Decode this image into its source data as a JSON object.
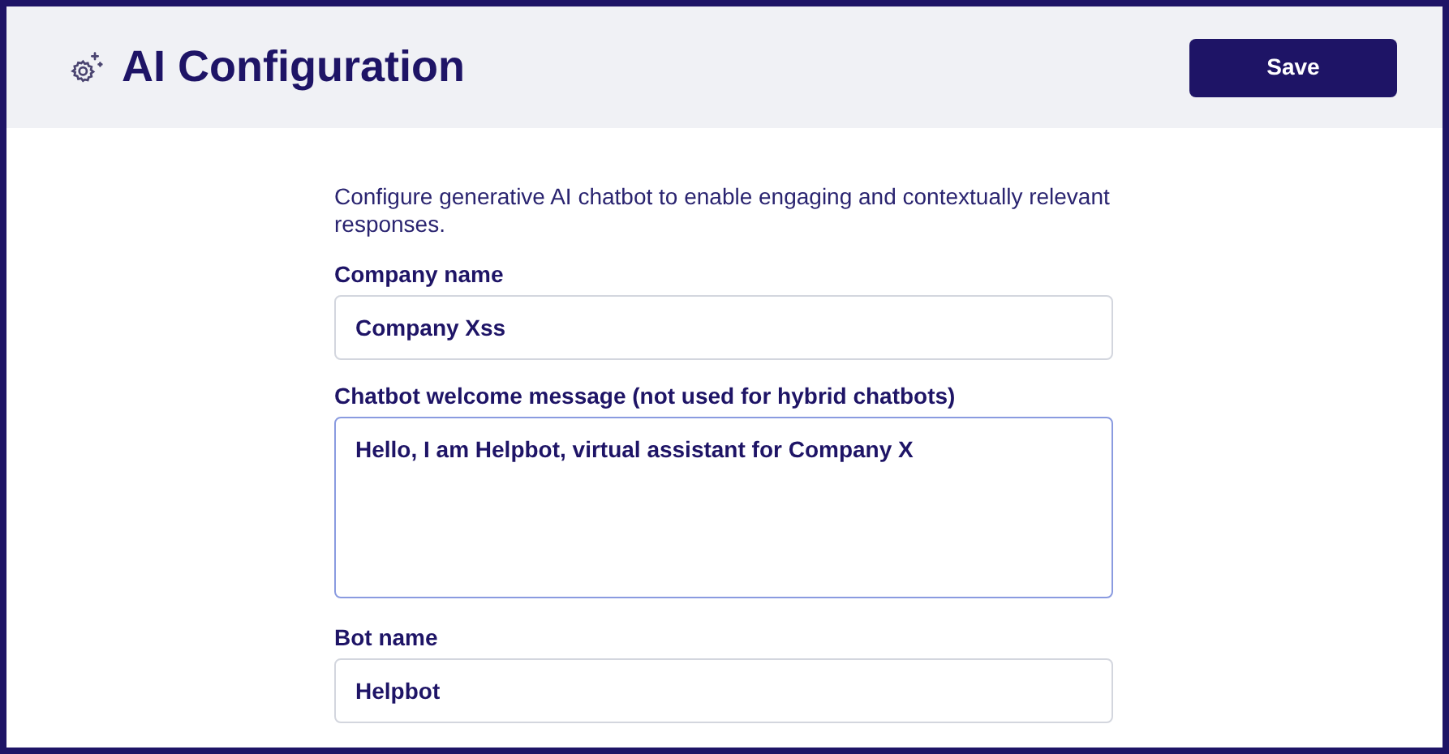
{
  "header": {
    "title": "AI Configuration",
    "save_button": "Save"
  },
  "description": "Configure generative AI chatbot to enable engaging and contextually relevant responses.",
  "fields": [
    {
      "label": "Company name",
      "kind": "input",
      "value": "Company Xss",
      "focused": false
    },
    {
      "label": "Chatbot welcome message (not used for hybrid chatbots)",
      "kind": "textarea",
      "value": "Hello, I am Helpbot, virtual assistant for Company X",
      "focused": true
    },
    {
      "label": "Bot name",
      "kind": "input",
      "value": "Helpbot",
      "focused": false
    }
  ]
}
